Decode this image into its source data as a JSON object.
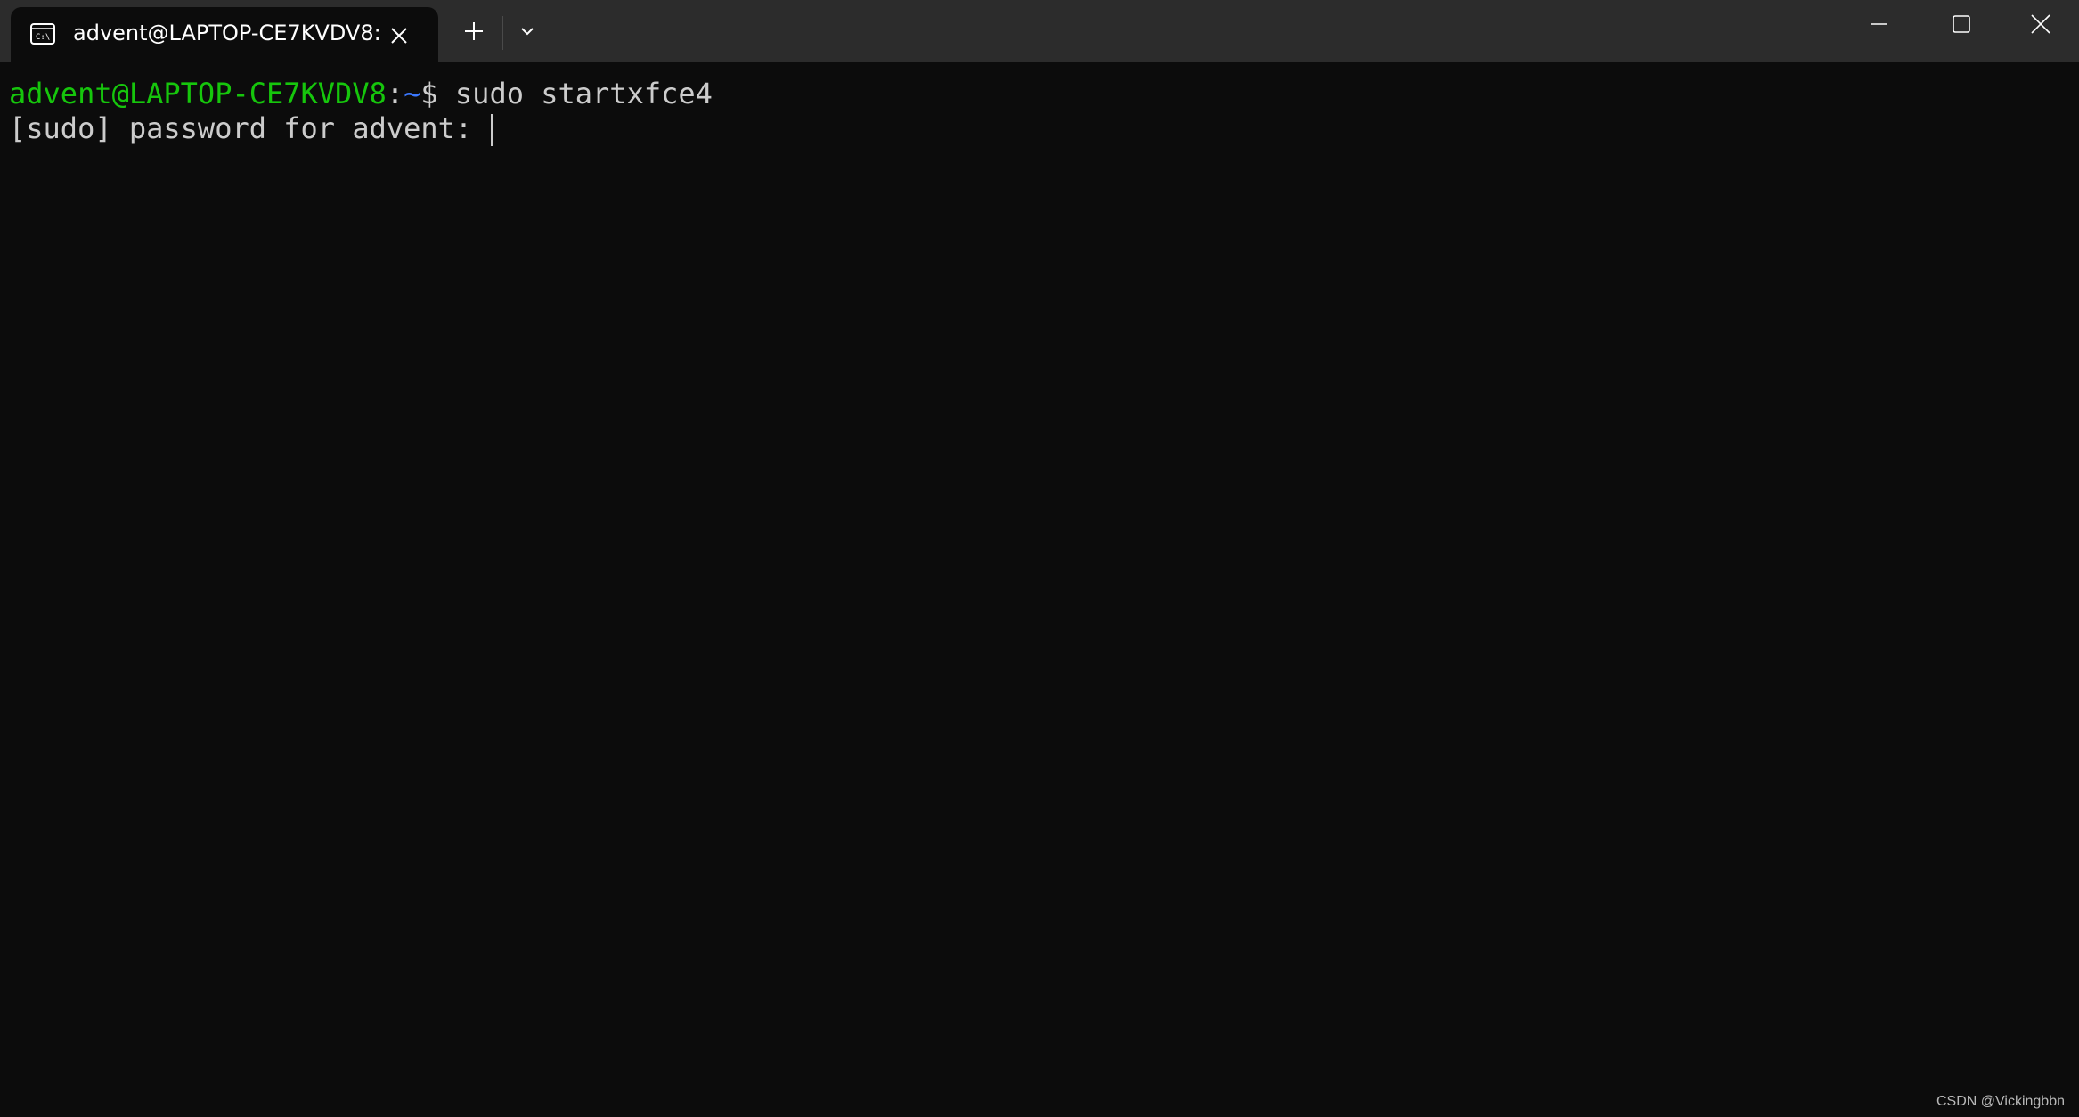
{
  "window": {
    "tab": {
      "title": "advent@LAPTOP-CE7KVDV8:",
      "icon": "terminal-icon",
      "close_icon": "close-icon"
    },
    "new_tab_icon": "plus-icon",
    "dropdown_icon": "chevron-down-icon",
    "caption_buttons": [
      "minimize-icon",
      "maximize-icon",
      "close-icon"
    ]
  },
  "terminal": {
    "lines": [
      {
        "user_host": "advent@LAPTOP-CE7KVDV8",
        "separator": ":",
        "path": "~",
        "dollar": "$",
        "command": " sudo startxfce4"
      },
      {
        "text": "[sudo] password for advent: "
      }
    ]
  },
  "watermark": "CSDN @Vickingbbn",
  "colors": {
    "titlebar_bg": "#2c2c2c",
    "terminal_bg": "#0c0c0c",
    "prompt_green": "#16c60c",
    "prompt_blue": "#3b78ff",
    "text": "#cccccc"
  }
}
